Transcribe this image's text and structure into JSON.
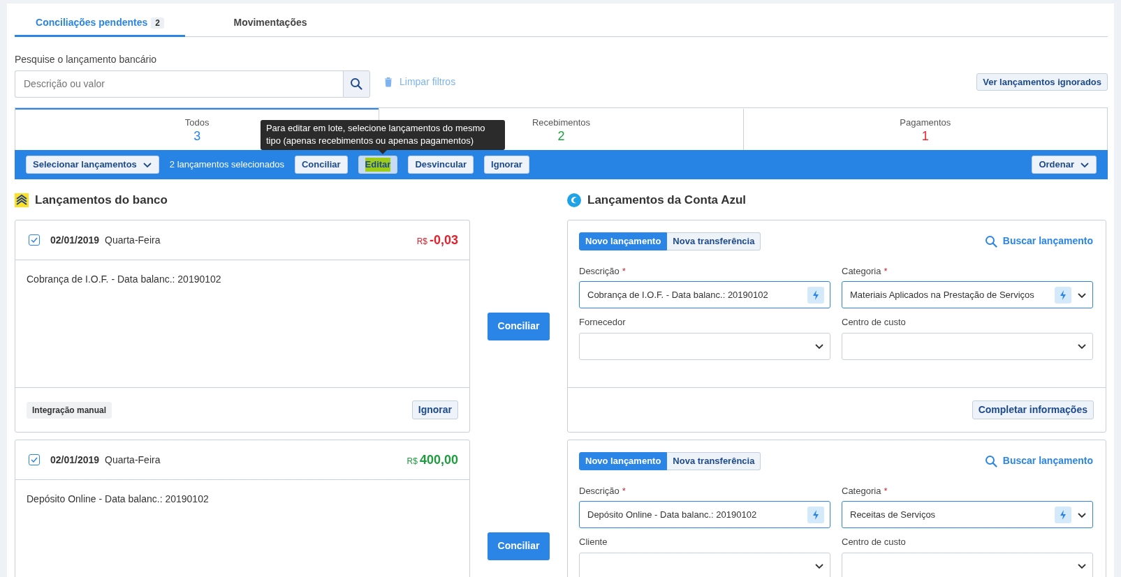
{
  "tabs": [
    {
      "label": "Conciliações pendentes",
      "badge": "2",
      "selected": true
    },
    {
      "label": "Movimentações",
      "selected": false
    }
  ],
  "search": {
    "label": "Pesquise o lançamento bancário",
    "placeholder": "Descrição ou valor"
  },
  "clear_filters": "Limpar filtros",
  "ignored_button": "Ver lançamentos ignorados",
  "filters": [
    {
      "label": "Todos",
      "count": "3",
      "color": "#2a85e6",
      "selected": true
    },
    {
      "label": "Recebimentos",
      "count": "2",
      "color": "#1ea43c",
      "selected": false
    },
    {
      "label": "Pagamentos",
      "count": "1",
      "color": "#ec2530",
      "selected": false
    }
  ],
  "action_bar": {
    "select_menu": "Selecionar lançamentos",
    "selected_count": "2 lançamentos selecionados",
    "sort": "Ordenar",
    "buttons": [
      {
        "label": "Conciliar",
        "highlighted": false
      },
      {
        "label": "Editar",
        "highlighted": true
      },
      {
        "label": "Desvincular",
        "highlighted": false
      },
      {
        "label": "Ignorar",
        "highlighted": false
      }
    ]
  },
  "tooltip": "Para editar em lote, selecione lançamentos do mesmo tipo (apenas recebimentos ou apenas pagamentos)",
  "bank_heading": "Lançamentos do banco",
  "app_heading": "Lançamentos da Conta Azul",
  "entries": [
    {
      "checked": true,
      "date": "02/01/2019",
      "weekday": "Quarta-Feira",
      "currency": "R$",
      "amount": "-0,03",
      "kind": "debit",
      "description": "Cobrança de I.O.F. - Data balanc.: 20190102",
      "tag": "Integração manual",
      "ignore": "Ignorar",
      "action": "Conciliar",
      "form": {
        "modes": [
          {
            "label": "Novo lançamento",
            "selected": true
          },
          {
            "label": "Nova transferência",
            "selected": false
          }
        ],
        "search": "Buscar lançamento",
        "fields": [
          {
            "label": "Descrição",
            "required_mark": "*",
            "kind": "text-auto",
            "value": "Cobrança de I.O.F. - Data balanc.: 20190102"
          },
          {
            "label": "Categoria",
            "required_mark": "*",
            "kind": "select-auto",
            "value": "Materiais Aplicados na Prestação de Serviços"
          },
          {
            "label": "Fornecedor",
            "kind": "select"
          },
          {
            "label": "Centro de custo",
            "kind": "select"
          }
        ],
        "complete": "Completar informações"
      }
    },
    {
      "checked": true,
      "date": "02/01/2019",
      "weekday": "Quarta-Feira",
      "currency": "R$",
      "amount": "400,00",
      "kind": "credit",
      "description": "Depósito Online - Data balanc.: 20190102",
      "action": "Conciliar",
      "form": {
        "modes": [
          {
            "label": "Novo lançamento",
            "selected": true
          },
          {
            "label": "Nova transferência",
            "selected": false
          }
        ],
        "search": "Buscar lançamento",
        "fields": [
          {
            "label": "Descrição",
            "required_mark": "*",
            "kind": "text-auto",
            "value": "Depósito Online - Data balanc.: 20190102"
          },
          {
            "label": "Categoria",
            "required_mark": "*",
            "kind": "select-auto",
            "value": "Receitas de Serviços"
          },
          {
            "label": "Cliente",
            "kind": "select"
          },
          {
            "label": "Centro de custo",
            "kind": "select"
          }
        ]
      }
    }
  ]
}
